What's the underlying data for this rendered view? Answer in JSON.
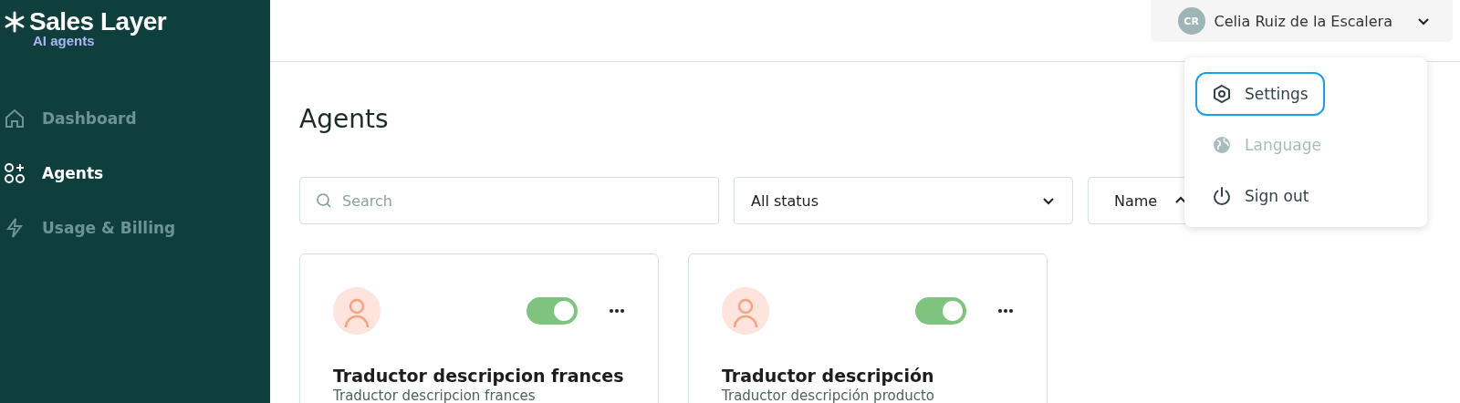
{
  "brand": {
    "name": "Sales Layer",
    "subtitle": "AI agents"
  },
  "nav": [
    {
      "label": "Dashboard",
      "kind": "home",
      "selected": false
    },
    {
      "label": "Agents",
      "kind": "agents",
      "selected": true
    },
    {
      "label": "Usage & Billing",
      "kind": "bolt",
      "selected": false
    }
  ],
  "user": {
    "initials": "CR",
    "name": "Celia Ruiz de la Escalera"
  },
  "user_menu": [
    {
      "label": "Settings",
      "kind": "gear",
      "selected": true,
      "disabled": false
    },
    {
      "label": "Language",
      "kind": "globe",
      "selected": false,
      "disabled": true
    },
    {
      "label": "Sign out",
      "kind": "power",
      "selected": false,
      "disabled": false
    }
  ],
  "page_title": "Agents",
  "search": {
    "placeholder": "Search"
  },
  "status_filter": {
    "value": "All status"
  },
  "sort": {
    "value": "Name"
  },
  "agents": [
    {
      "name": "Traductor descripcion frances",
      "description": "Traductor descripcion frances",
      "on": true
    },
    {
      "name": "Traductor descripción",
      "description": "Traductor descripción producto",
      "on": true
    }
  ]
}
